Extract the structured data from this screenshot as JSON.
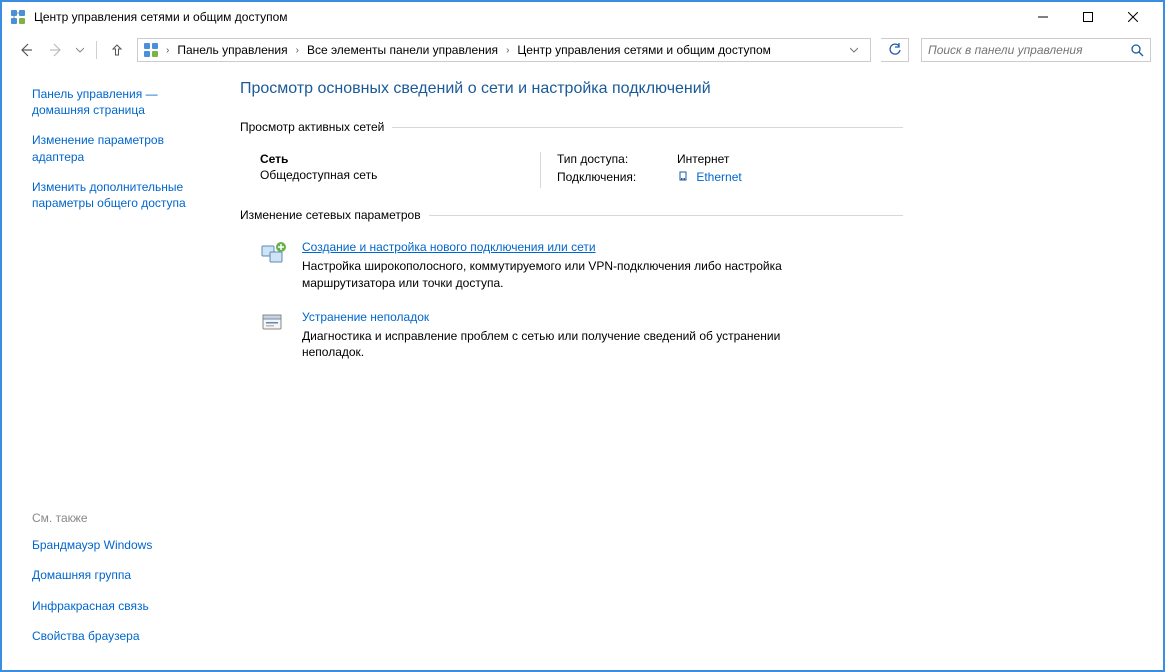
{
  "window": {
    "title": "Центр управления сетями и общим доступом"
  },
  "breadcrumbs": {
    "item1": "Панель управления",
    "item2": "Все элементы панели управления",
    "item3": "Центр управления сетями и общим доступом"
  },
  "search": {
    "placeholder": "Поиск в панели управления"
  },
  "sidebar": {
    "link1": "Панель управления — домашняя страница",
    "link2": "Изменение параметров адаптера",
    "link3": "Изменить дополнительные параметры общего доступа",
    "see_also_header": "См. также",
    "also1": "Брандмауэр Windows",
    "also2": "Домашняя группа",
    "also3": "Инфракрасная связь",
    "also4": "Свойства браузера"
  },
  "content": {
    "heading": "Просмотр основных сведений о сети и настройка подключений",
    "active_nets_label": "Просмотр активных сетей",
    "net": {
      "name": "Сеть",
      "type": "Общедоступная сеть",
      "access_label": "Тип доступа:",
      "access_value": "Интернет",
      "conn_label": "Подключения:",
      "conn_value": "Ethernet"
    },
    "change_settings_label": "Изменение сетевых параметров",
    "task1": {
      "title": "Создание и настройка нового подключения или сети",
      "desc": "Настройка широкополосного, коммутируемого или VPN-подключения либо настройка маршрутизатора или точки доступа."
    },
    "task2": {
      "title": "Устранение неполадок",
      "desc": "Диагностика и исправление проблем с сетью или получение сведений об устранении неполадок."
    }
  }
}
